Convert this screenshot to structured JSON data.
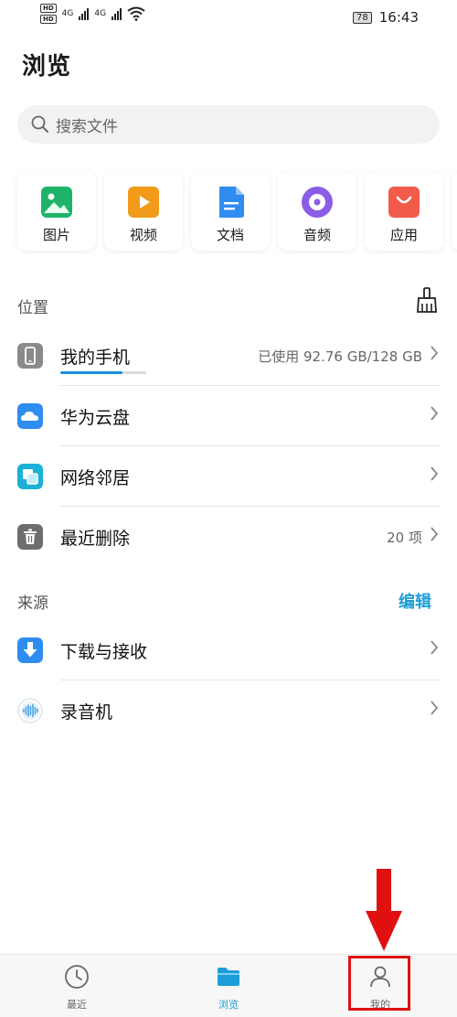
{
  "status_bar": {
    "hd1": "HD",
    "hd2": "HD",
    "net1": "4G",
    "net2": "4G",
    "battery": "78",
    "time": "16:43"
  },
  "title": "浏览",
  "search": {
    "placeholder": "搜索文件"
  },
  "categories": [
    {
      "label": "图片",
      "icon": "image-icon",
      "color": "#1fb36a"
    },
    {
      "label": "视频",
      "icon": "video-icon",
      "color": "#f29a1a"
    },
    {
      "label": "文档",
      "icon": "document-icon",
      "color": "#2f8cf0"
    },
    {
      "label": "音频",
      "icon": "music-icon",
      "color": "#8b5ce6"
    },
    {
      "label": "应用",
      "icon": "app-store-icon",
      "color": "#f25a4a"
    }
  ],
  "location": {
    "header": "位置",
    "items": [
      {
        "label": "我的手机",
        "value": "已使用 92.76 GB/128 GB",
        "icon": "phone-icon",
        "color": "#8a8a8a",
        "usage_fraction": 0.72
      },
      {
        "label": "华为云盘",
        "value": "",
        "icon": "cloud-icon",
        "color": "#2f8cf0"
      },
      {
        "label": "网络邻居",
        "value": "",
        "icon": "network-icon",
        "color": "#1bb1d6"
      },
      {
        "label": "最近删除",
        "value": "20 项",
        "icon": "trash-icon",
        "color": "#6d6d6d"
      }
    ]
  },
  "sources": {
    "header": "来源",
    "edit_label": "编辑",
    "items": [
      {
        "label": "下载与接收",
        "icon": "download-icon",
        "color": "#2f8cf0"
      },
      {
        "label": "录音机",
        "icon": "recorder-icon",
        "color": "#4aa3e0"
      }
    ]
  },
  "tabbar": {
    "tabs": [
      {
        "label": "最近",
        "icon": "clock-icon"
      },
      {
        "label": "浏览",
        "icon": "folder-icon",
        "active": true
      },
      {
        "label": "我的",
        "icon": "person-icon"
      }
    ]
  },
  "accent_color": "#1e9ed8",
  "annotation_color": "#e01010"
}
